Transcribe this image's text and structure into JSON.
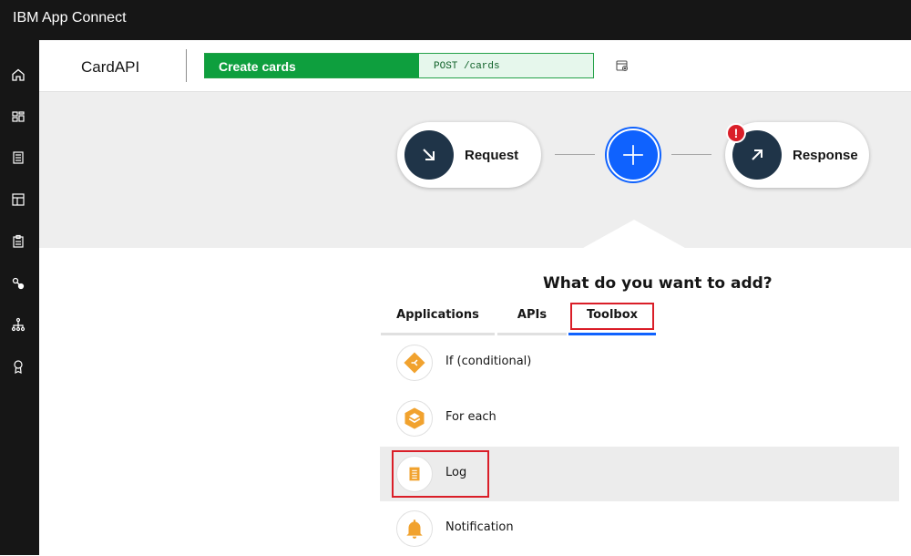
{
  "app": {
    "title": "IBM App Connect"
  },
  "leftnav": {
    "icons": [
      "home-icon",
      "dashboard-icon",
      "catalog-icon",
      "templates-icon",
      "clipboard-icon",
      "connections-icon",
      "flow-tree-icon",
      "badge-icon"
    ]
  },
  "header": {
    "api_name": "CardAPI",
    "operation": {
      "name": "Create cards",
      "method_path": "POST /cards"
    },
    "doc_icon": "document-settings-icon"
  },
  "flow": {
    "request_label": "Request",
    "response_label": "Response",
    "error_badge": "!"
  },
  "panel": {
    "title": "What do you want to add?",
    "tabs": [
      {
        "label": "Applications",
        "active": false
      },
      {
        "label": "APIs",
        "active": false
      },
      {
        "label": "Toolbox",
        "active": true
      }
    ],
    "items": [
      {
        "label": "If (conditional)",
        "icon": "branch-icon",
        "selected": false
      },
      {
        "label": "For each",
        "icon": "stack-icon",
        "selected": false
      },
      {
        "label": "Log",
        "icon": "log-document-icon",
        "selected": true
      },
      {
        "label": "Notification",
        "icon": "bell-icon",
        "selected": false
      }
    ]
  },
  "colors": {
    "accent": "#0f62fe",
    "op_green": "#0e9f3e",
    "node_dark": "#1f3448",
    "toolbox_orange": "#f1a22e",
    "error_red": "#da1e28",
    "highlight_red": "#da1e28"
  }
}
